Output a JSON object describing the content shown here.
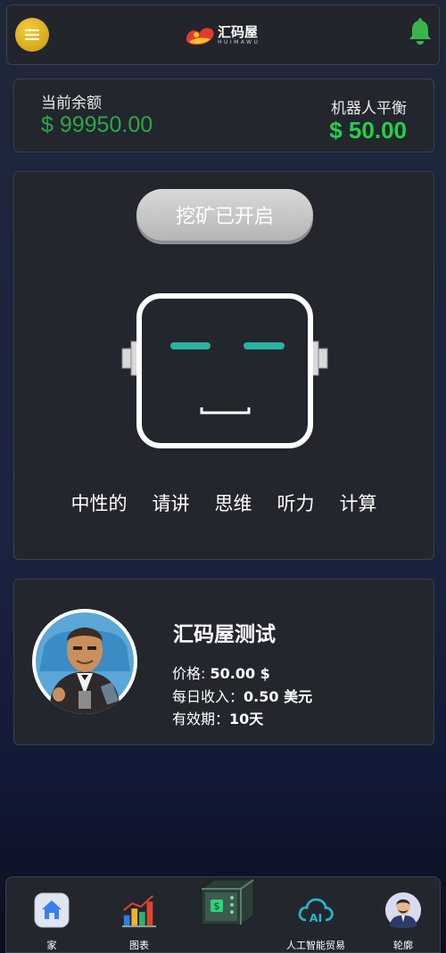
{
  "header": {
    "menu_icon": "hamburger-icon",
    "logo_title": "汇码屋",
    "logo_sub": "HUIMAWU",
    "bell_icon": "bell-icon",
    "accent": "#f1c232",
    "bell_color": "#3bb54a"
  },
  "balance": {
    "label": "当前余额",
    "value": "$ 99950.00",
    "robot_label": "机器人平衡",
    "robot_value": "$ 50.00",
    "value_color": "#2aa84a",
    "robot_value_color": "#22d14a"
  },
  "mining": {
    "button_label": "挖矿已开启",
    "robot_icon": "robot-face-icon",
    "modes": [
      "中性的",
      "请讲",
      "思维",
      "听力",
      "计算"
    ]
  },
  "product": {
    "avatar_icon": "businessman-avatar",
    "name": "汇码屋测试",
    "price_label": "价格: ",
    "price_value": "50.00 $",
    "income_label": "每日收入：",
    "income_value": "0.50 美元",
    "validity_label": "有效期：",
    "validity_value": "10天"
  },
  "nav": {
    "items": [
      {
        "label": "家",
        "icon": "home-icon"
      },
      {
        "label": "图表",
        "icon": "bar-chart-icon"
      },
      {
        "label": "",
        "icon": "mining-device-icon"
      },
      {
        "label": "人工智能贸易",
        "icon": "ai-cloud-icon"
      },
      {
        "label": "轮廓",
        "icon": "user-avatar-icon"
      }
    ]
  }
}
